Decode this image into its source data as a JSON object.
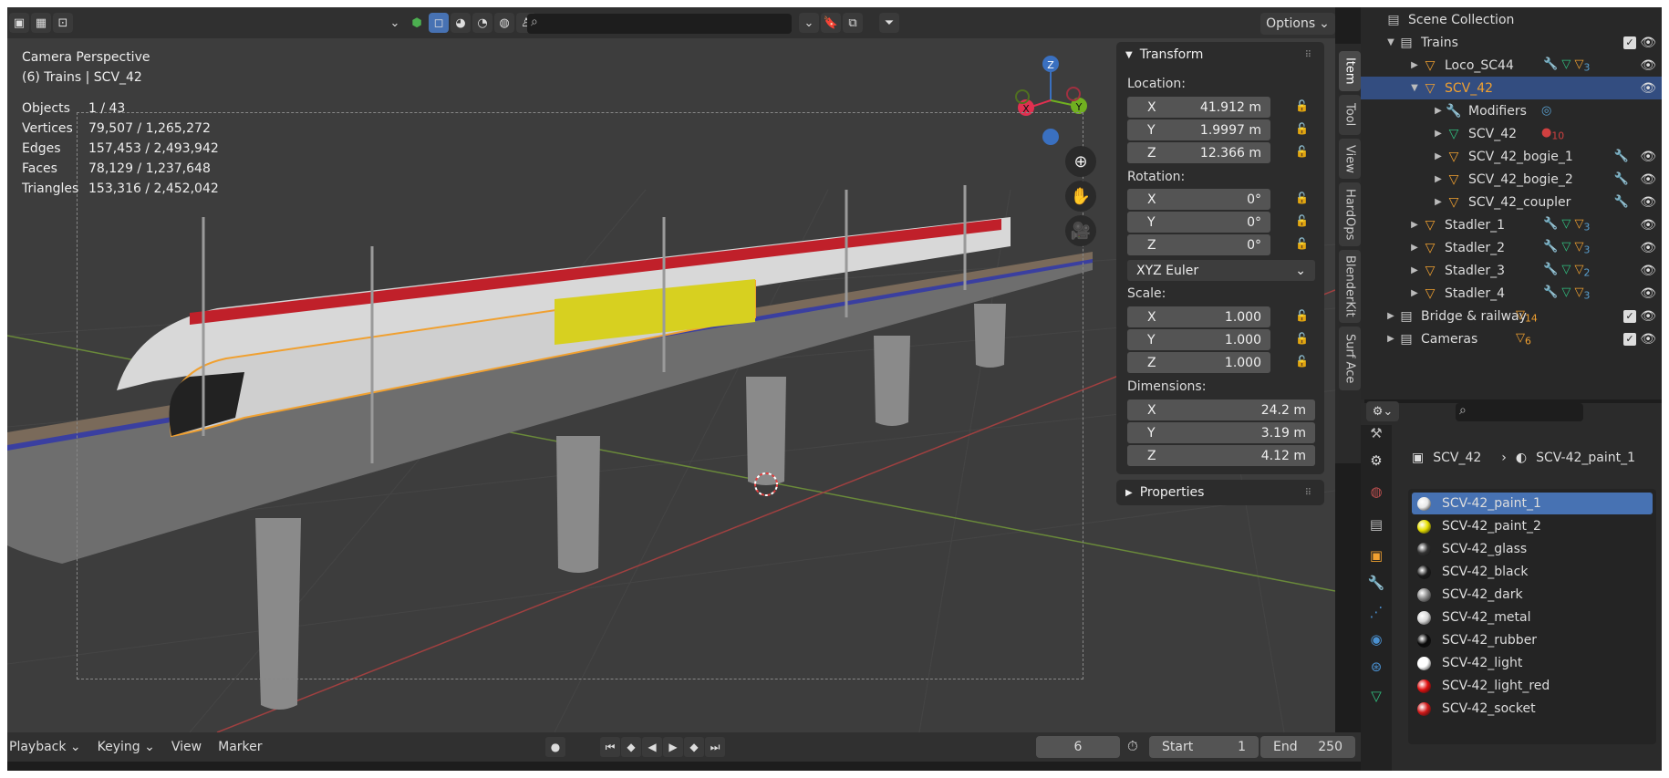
{
  "viewport": {
    "header": {
      "options_label": "Options"
    },
    "info": {
      "line1": "Camera Perspective",
      "line2": "(6) Trains | SCV_42"
    },
    "stats": [
      {
        "k": "Objects",
        "v": "1 / 43"
      },
      {
        "k": "Vertices",
        "v": "79,507 / 1,265,272"
      },
      {
        "k": "Edges",
        "v": "157,453 / 2,493,942"
      },
      {
        "k": "Faces",
        "v": "78,129 / 1,237,648"
      },
      {
        "k": "Triangles",
        "v": "153,316 / 2,452,042"
      }
    ],
    "gizmo": {
      "x": "X",
      "y": "Y",
      "z": "Z"
    }
  },
  "transform": {
    "title": "Transform",
    "location_label": "Location:",
    "location": [
      {
        "axis": "X",
        "value": "41.912 m"
      },
      {
        "axis": "Y",
        "value": "1.9997 m"
      },
      {
        "axis": "Z",
        "value": "12.366 m"
      }
    ],
    "rotation_label": "Rotation:",
    "rotation": [
      {
        "axis": "X",
        "value": "0°"
      },
      {
        "axis": "Y",
        "value": "0°"
      },
      {
        "axis": "Z",
        "value": "0°"
      }
    ],
    "rotation_mode": "XYZ Euler",
    "scale_label": "Scale:",
    "scale": [
      {
        "axis": "X",
        "value": "1.000"
      },
      {
        "axis": "Y",
        "value": "1.000"
      },
      {
        "axis": "Z",
        "value": "1.000"
      }
    ],
    "dimensions_label": "Dimensions:",
    "dimensions": [
      {
        "axis": "X",
        "value": "24.2 m"
      },
      {
        "axis": "Y",
        "value": "3.19 m"
      },
      {
        "axis": "Z",
        "value": "4.12 m"
      }
    ],
    "properties_label": "Properties"
  },
  "side_tabs": [
    "Item",
    "Tool",
    "View",
    "HardOps",
    "BlenderKit",
    "Surf Ace"
  ],
  "timeline": {
    "playback": "Playback",
    "keying": "Keying",
    "view": "View",
    "marker": "Marker",
    "current_frame": "6",
    "start_label": "Start",
    "start": "1",
    "end_label": "End",
    "end": "250"
  },
  "outliner": {
    "root": "Scene Collection",
    "rows": [
      {
        "label": "Trains",
        "indent": 1,
        "kind": "collection",
        "expanded": true,
        "check": true
      },
      {
        "label": "Loco_SC44",
        "indent": 2,
        "kind": "object",
        "mods": "3"
      },
      {
        "label": "SCV_42",
        "indent": 2,
        "kind": "object",
        "selected": true,
        "expanded": true
      },
      {
        "label": "Modifiers",
        "indent": 3,
        "kind": "modifiers"
      },
      {
        "label": "SCV_42",
        "indent": 3,
        "kind": "mesh",
        "badge": "10"
      },
      {
        "label": "SCV_42_bogie_1",
        "indent": 3,
        "kind": "object"
      },
      {
        "label": "SCV_42_bogie_2",
        "indent": 3,
        "kind": "object"
      },
      {
        "label": "SCV_42_coupler",
        "indent": 3,
        "kind": "object"
      },
      {
        "label": "Stadler_1",
        "indent": 2,
        "kind": "object",
        "mods": "3"
      },
      {
        "label": "Stadler_2",
        "indent": 2,
        "kind": "object",
        "mods": "3"
      },
      {
        "label": "Stadler_3",
        "indent": 2,
        "kind": "object",
        "mods": "2"
      },
      {
        "label": "Stadler_4",
        "indent": 2,
        "kind": "object",
        "mods": "3"
      },
      {
        "label": "Bridge & railway",
        "indent": 1,
        "kind": "collection",
        "count": "14",
        "check": true
      },
      {
        "label": "Cameras",
        "indent": 1,
        "kind": "collection",
        "count": "6",
        "check": true
      }
    ]
  },
  "properties": {
    "breadcrumb_object": "SCV_42",
    "breadcrumb_material": "SCV-42_paint_1",
    "materials": [
      {
        "name": "SCV-42_paint_1",
        "color": "#e8e8e8",
        "selected": true
      },
      {
        "name": "SCV-42_paint_2",
        "color": "#e8e000"
      },
      {
        "name": "SCV-42_glass",
        "color": "#333333"
      },
      {
        "name": "SCV-42_black",
        "color": "#1a1a1a"
      },
      {
        "name": "SCV-42_dark",
        "color": "#888888"
      },
      {
        "name": "SCV-42_metal",
        "color": "#d8d8d8"
      },
      {
        "name": "SCV-42_rubber",
        "color": "#0a0a0a"
      },
      {
        "name": "SCV-42_light",
        "color": "#ffffff"
      },
      {
        "name": "SCV-42_light_red",
        "color": "#e01010"
      },
      {
        "name": "SCV-42_socket",
        "color": "#d01818"
      }
    ]
  },
  "colors": {
    "accent": "#4772b3",
    "selection_outline": "#f0a030",
    "outliner_selected": "#334d80"
  }
}
